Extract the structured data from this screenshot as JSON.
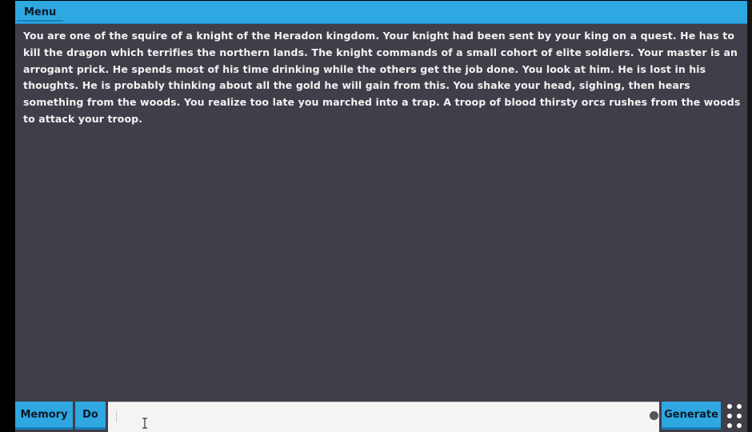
{
  "menu": {
    "label": "Menu"
  },
  "story": {
    "text": "You are one of the squire of a knight of the Heradon kingdom. Your knight had been sent by your king on a quest. He has to kill the dragon which terrifies the northern lands. The knight commands of a small cohort of elite soldiers. Your master is an arrogant prick. He spends most of his time drinking while the others get the job done. You look at him. He is lost in his thoughts. He is probably thinking about all the gold he will gain from this. You shake your head, sighing, then hears something from the woods. You realize too late you marched into a trap.  A troop of blood thirsty orcs rushes from the woods to attack your troop."
  },
  "bottom_bar": {
    "memory_label": "Memory",
    "do_label": "Do",
    "input_value": "",
    "generate_label": "Generate"
  },
  "icons": {
    "input_status": "dot-indicator-icon",
    "more": "grid-dots-icon"
  },
  "colors": {
    "accent": "#2fa7e0",
    "background": "#403e48",
    "text": "#f2f2f2"
  }
}
